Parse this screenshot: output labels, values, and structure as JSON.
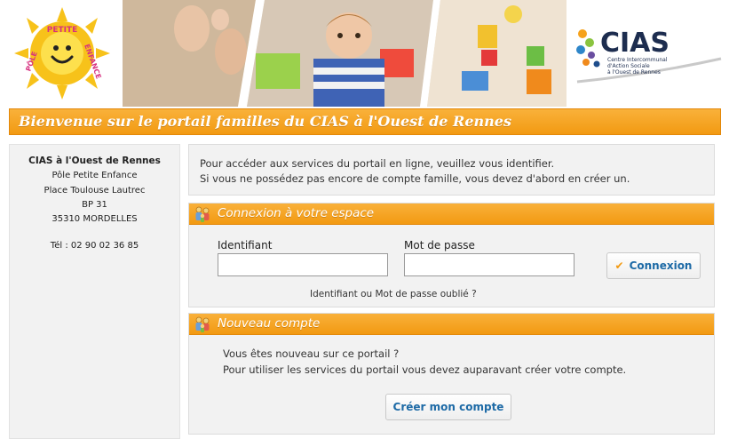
{
  "banner": {
    "logo_left_text": "PÔLE PETITE ENFANCE",
    "logo_right_title": "CIAS",
    "logo_right_subtitle": [
      "Centre Intercommunal",
      "d'Action Sociale",
      "à l'Ouest de Rennes"
    ]
  },
  "title_bar": {
    "text": "Bienvenue sur le portail familles du CIAS à l'Ouest de Rennes"
  },
  "sidebar": {
    "org_name": "CIAS à l'Ouest de Rennes",
    "address_lines": [
      "Pôle Petite Enfance",
      "Place Toulouse Lautrec",
      "BP 31",
      "35310 MORDELLES"
    ],
    "phone": "Tél : 02 90 02 36 85"
  },
  "intro": {
    "line1": "Pour accéder aux services du portail en ligne, veuillez vous identifier.",
    "line2": "Si vous ne possédez pas encore de compte famille, vous devez d'abord en créer un."
  },
  "login": {
    "header": "Connexion à votre espace",
    "identifier_label": "Identifiant",
    "identifier_value": "",
    "password_label": "Mot de passe",
    "password_value": "",
    "submit_label": "Connexion",
    "forgot_link": "Identifiant ou Mot de passe oublié ?"
  },
  "new_account": {
    "header": "Nouveau compte",
    "line1": "Vous êtes nouveau sur ce portail ?",
    "line2": "Pour utiliser les services du portail vous devez auparavant créer votre compte.",
    "create_label": "Créer mon compte"
  },
  "colors": {
    "accent_orange": "#f29a12",
    "link_blue": "#1d6aa6",
    "panel_grey": "#f2f2f2"
  },
  "icons": {
    "submit": "check-icon",
    "panel_headers": "family-icon"
  }
}
